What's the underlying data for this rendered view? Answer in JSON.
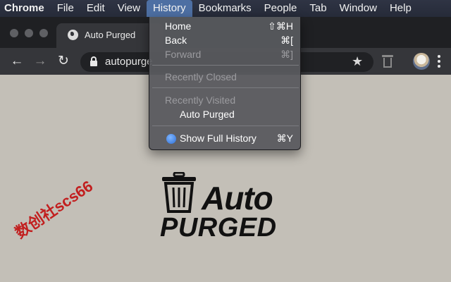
{
  "menubar": {
    "items": [
      "Chrome",
      "File",
      "Edit",
      "View",
      "History",
      "Bookmarks",
      "People",
      "Tab",
      "Window",
      "Help"
    ]
  },
  "tab": {
    "title": "Auto Purged",
    "favicon": "globe-icon"
  },
  "omnibox": {
    "url": "autopurge"
  },
  "history_menu": {
    "home": {
      "label": "Home",
      "shortcut": "⇧⌘H"
    },
    "back": {
      "label": "Back",
      "shortcut": "⌘["
    },
    "forward": {
      "label": "Forward",
      "shortcut": "⌘]",
      "disabled": true
    },
    "recently_closed": {
      "label": "Recently Closed",
      "disabled": true
    },
    "recently_visited": {
      "label": "Recently Visited",
      "disabled": true
    },
    "visited_item": {
      "label": "Auto Purged"
    },
    "show_full_history": {
      "label": "Show Full History",
      "shortcut": "⌘Y"
    }
  },
  "page": {
    "logo_line1": "Auto",
    "logo_line2": "PURGED",
    "watermark": "数创社scs66"
  },
  "colors": {
    "menubar_bg": "#2a2f3e",
    "menu_active": "#4d6fa3",
    "page_bg": "#c3bfb7",
    "watermark": "#c21f1f"
  }
}
